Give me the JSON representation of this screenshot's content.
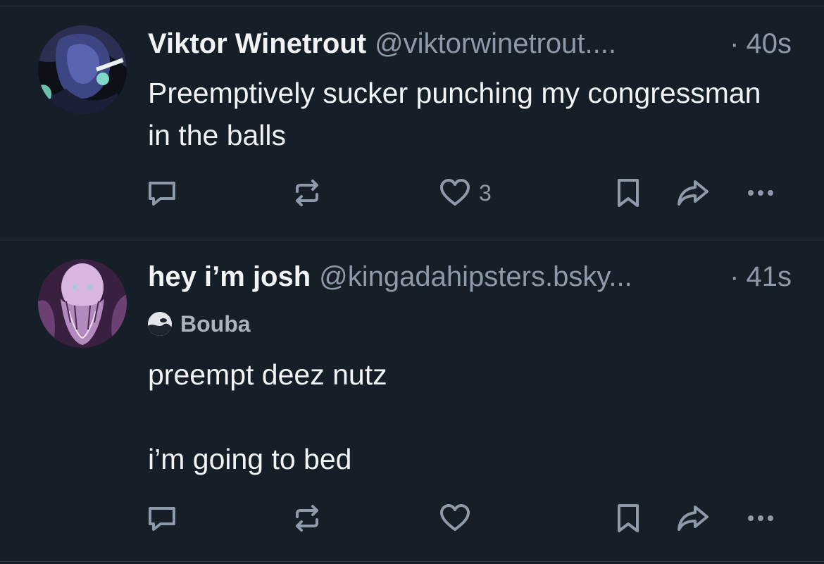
{
  "posts": [
    {
      "author": "Viktor Winetrout",
      "handle": "@viktorwinetrout....",
      "time": "40s",
      "badge": null,
      "paragraphs": [
        "Preemptively sucker punching my congressman in the balls"
      ],
      "likes": "3"
    },
    {
      "author": "hey i’m josh",
      "handle": "@kingadahipsters.bsky...",
      "time": "41s",
      "badge": "Bouba",
      "paragraphs": [
        "preempt deez nutz",
        "i’m going to bed"
      ],
      "likes": ""
    }
  ],
  "separator": "·",
  "icons": {
    "reply": "reply-bubble-icon",
    "repost": "repost-arrows-icon",
    "like": "heart-icon",
    "save": "bookmark-icon",
    "share": "share-arrow-icon",
    "more": "ellipsis-icon"
  },
  "colors": {
    "background": "#161e27",
    "primary_text": "#f1f3f5",
    "secondary_text": "#8d9aaa",
    "divider": "#2a3440"
  }
}
